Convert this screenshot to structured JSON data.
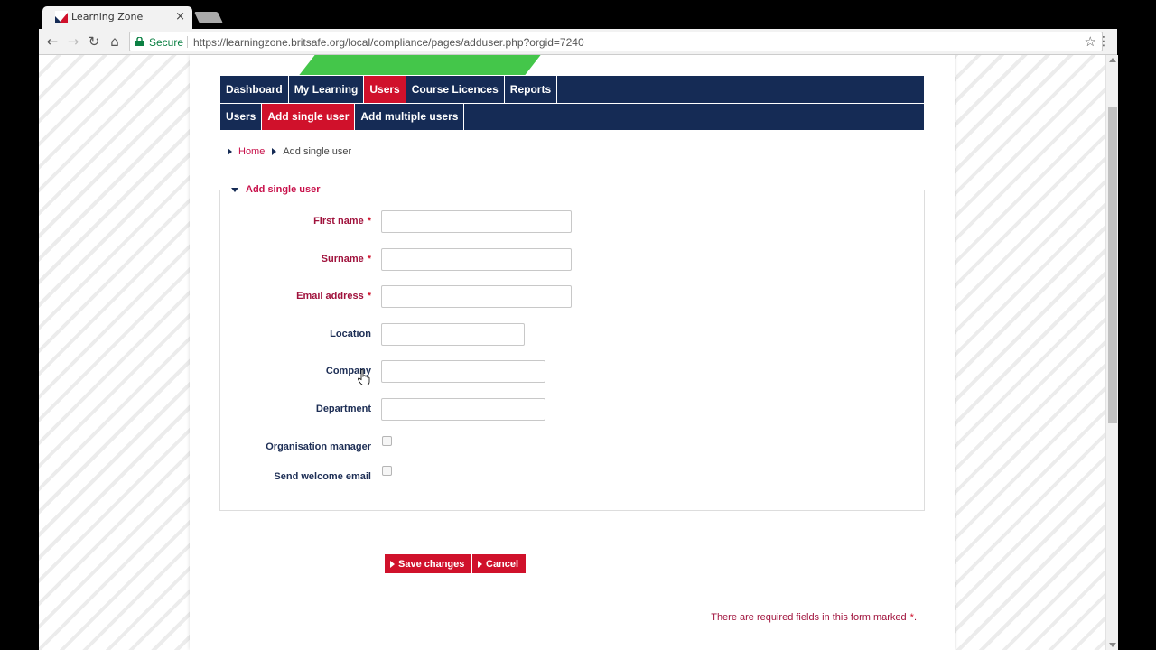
{
  "browser": {
    "tab_title": "Learning Zone",
    "tab_close": "×",
    "secure_label": "Secure",
    "url": "https://learningzone.britsafe.org/local/compliance/pages/adduser.php?orgid=7240",
    "back_icon": "←",
    "forward_icon": "→",
    "reload_icon": "↻",
    "home_icon": "⌂",
    "star_icon": "☆",
    "menu_icon": "⋮"
  },
  "nav": {
    "primary": [
      {
        "label": "Dashboard"
      },
      {
        "label": "My Learning"
      },
      {
        "label": "Users"
      },
      {
        "label": "Course Licences"
      },
      {
        "label": "Reports"
      }
    ],
    "primary_active_index": 2,
    "secondary": [
      {
        "label": "Users"
      },
      {
        "label": "Add single user"
      },
      {
        "label": "Add multiple users"
      }
    ],
    "secondary_active_index": 1
  },
  "breadcrumb": {
    "home": "Home",
    "current": "Add single user"
  },
  "form": {
    "legend": "Add single user",
    "required_marker": "*",
    "fields": {
      "first_name": {
        "label": "First name",
        "value": "",
        "required": true
      },
      "surname": {
        "label": "Surname",
        "value": "",
        "required": true
      },
      "email": {
        "label": "Email address",
        "value": "",
        "required": true
      },
      "location": {
        "label": "Location",
        "value": "",
        "required": false
      },
      "company": {
        "label": "Company",
        "value": "",
        "required": false
      },
      "department": {
        "label": "Department",
        "value": "",
        "required": false
      },
      "organisation_manager": {
        "label": "Organisation manager",
        "checked": false
      },
      "send_welcome_email": {
        "label": "Send welcome email",
        "checked": false
      }
    },
    "save_label": "Save changes",
    "cancel_label": "Cancel",
    "required_note": "There are required fields in this form marked",
    "required_note_end": "."
  },
  "colors": {
    "nav_bg": "#152b55",
    "accent_red": "#d0112b",
    "label_required": "#a0123c",
    "logo_green": "#44c64a"
  }
}
